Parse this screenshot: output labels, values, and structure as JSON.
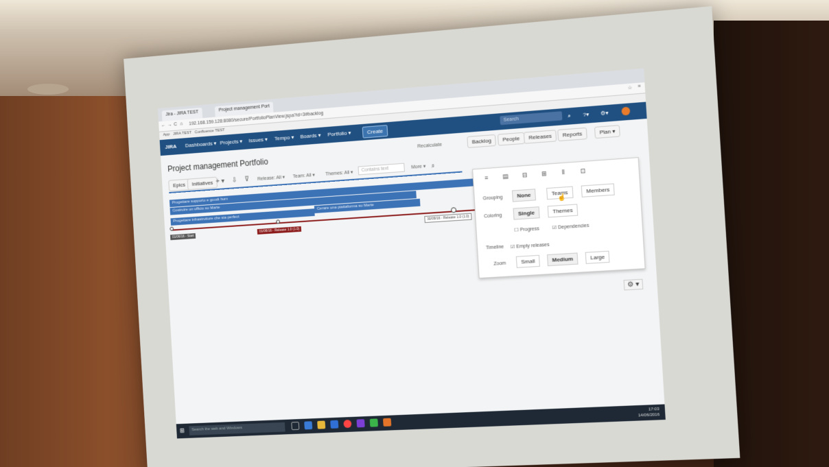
{
  "browser": {
    "tabs": [
      "Jira - JIRA TEST",
      "Project management Port"
    ],
    "url": "192.168.159.128:8080/secure/PortfolioPlanView.jspa?id=3#backlog",
    "bookmarks": [
      "App",
      "JIRA TEST",
      "Confluence TEST"
    ]
  },
  "jira": {
    "logo": "JIRA",
    "menu": [
      "Dashboards ▾",
      "Projects ▾",
      "Issues ▾",
      "Tempo ▾",
      "Boards ▾",
      "Portfolio ▾"
    ],
    "create": "Create",
    "search_placeholder": "Search"
  },
  "plan": {
    "title": "Project management Portfolio",
    "recalculate": "Recalculate",
    "views": [
      "Backlog",
      "People",
      "Releases",
      "Reports"
    ],
    "plan_menu": "Plan ▾",
    "epics": "Epics",
    "initiatives": "Initiatives",
    "filters": {
      "release": "Release: All ▾",
      "team": "Team: All ▾",
      "themes": "Themes: All ▾",
      "contains_placeholder": "Contains text",
      "more": "More ▾"
    }
  },
  "bars": [
    {
      "label": "Progettare supporto e goodt hum"
    },
    {
      "label": "Costruire un ufficio su Marte"
    },
    {
      "label": "Cerare una piattaforma su Marte"
    },
    {
      "label": "Progettare infrastrutture che sia perfect"
    }
  ],
  "timeline": {
    "start": "01/06/16 - Start",
    "release1": "01/06/16 - Release 1.0 (1.0)",
    "release2": "30/09/16 - Release 1.0 (1.0)"
  },
  "settings": {
    "grouping_label": "Grouping",
    "grouping": [
      "None",
      "Teams",
      "Members"
    ],
    "coloring_label": "Coloring",
    "coloring": [
      "Single",
      "Themes"
    ],
    "progress": "Progress",
    "dependencies": "Dependencies",
    "timeline_label": "Timeline",
    "empty_releases": "Empty releases",
    "zoom_label": "Zoom",
    "zoom": [
      "Small",
      "Medium",
      "Large"
    ]
  },
  "taskbar": {
    "search_placeholder": "Search the web and Windows",
    "time": "17:03",
    "date": "14/06/2016"
  }
}
